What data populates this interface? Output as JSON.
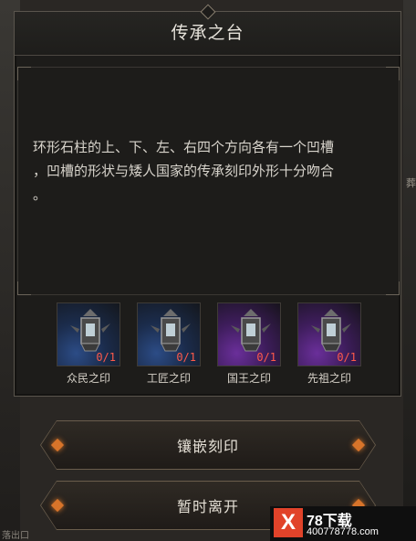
{
  "dialog": {
    "title": "传承之台",
    "description_lines": [
      "环形石柱的上、下、左、右四个方向各有一个凹槽",
      "，凹槽的形状与矮人国家的传承刻印外形十分吻合",
      "。"
    ]
  },
  "items": [
    {
      "name": "众民之印",
      "count": "0/1",
      "rarity": "blue"
    },
    {
      "name": "工匠之印",
      "count": "0/1",
      "rarity": "blue"
    },
    {
      "name": "国王之印",
      "count": "0/1",
      "rarity": "purple"
    },
    {
      "name": "先祖之印",
      "count": "0/1",
      "rarity": "purple"
    }
  ],
  "buttons": {
    "inlay": "镶嵌刻印",
    "leave": "暂时离开"
  },
  "background": {
    "right_text": "葬",
    "bottom_left_text": "落出口"
  },
  "watermark": {
    "logo": "X",
    "title": "78下载",
    "url": "400778778.com"
  },
  "colors": {
    "count_red": "#ff5a4a",
    "gem_orange": "#d8742a",
    "blue_rarity": "#2c4c86",
    "purple_rarity": "#6a2f9a"
  }
}
